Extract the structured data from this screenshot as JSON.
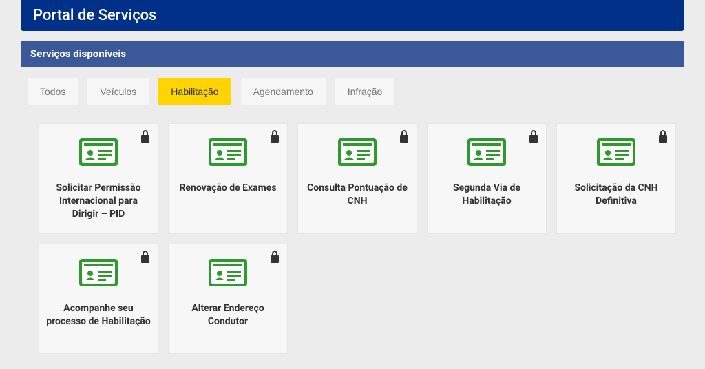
{
  "header": {
    "title": "Portal de Serviços"
  },
  "subheader": {
    "title": "Serviços disponíveis"
  },
  "tabs": [
    {
      "label": "Todos",
      "active": false
    },
    {
      "label": "Veículos",
      "active": false
    },
    {
      "label": "Habilitação",
      "active": true
    },
    {
      "label": "Agendamento",
      "active": false
    },
    {
      "label": "Infração",
      "active": false
    }
  ],
  "cards": [
    {
      "title": "Solicitar Permissão Internacional para Dirigir – PID",
      "locked": true
    },
    {
      "title": "Renovação de Exames",
      "locked": true
    },
    {
      "title": "Consulta Pontuação de CNH",
      "locked": true
    },
    {
      "title": "Segunda Via de Habilitação",
      "locked": true
    },
    {
      "title": "Solicitação da CNH Definitiva",
      "locked": true
    },
    {
      "title": "Acompanhe seu processo de Habilitação",
      "locked": true
    },
    {
      "title": "Alterar Endereço Condutor",
      "locked": true
    }
  ],
  "colors": {
    "header_bg": "#003087",
    "subheader_bg": "#3b5998",
    "tab_active_bg": "#ffd400",
    "card_icon_green": "#2e9a2e"
  }
}
